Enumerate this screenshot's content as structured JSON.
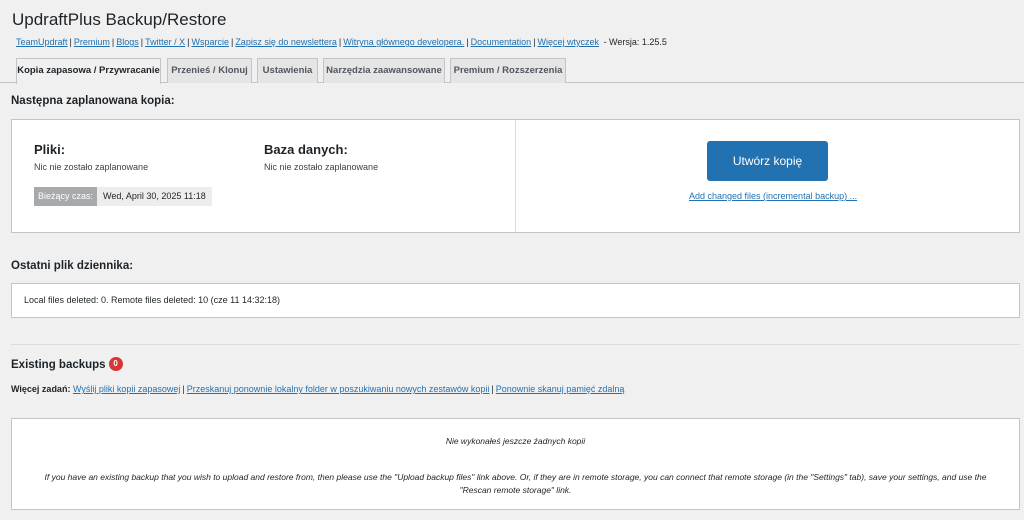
{
  "header": {
    "title": "UpdraftPlus Backup/Restore",
    "links": [
      "TeamUpdraft",
      "Premium",
      "Blogs",
      "Twitter / X",
      "Wsparcie",
      "Zapisz się do newslettera",
      "Witryna głównego developera.",
      "Documentation",
      "Więcej wtyczek"
    ],
    "version": "- Wersja: 1.25.5"
  },
  "tabs": [
    {
      "label": "Kopia zapasowa / Przywracanie",
      "active": true
    },
    {
      "label": "Przenieś / Klonuj",
      "active": false
    },
    {
      "label": "Ustawienia",
      "active": false
    },
    {
      "label": "Narzędzia zaawansowane",
      "active": false
    },
    {
      "label": "Premium / Rozszerzenia",
      "active": false
    }
  ],
  "next_backup": {
    "heading": "Następna zaplanowana kopia:",
    "files_label": "Pliki:",
    "files_value": "Nic nie zostało zaplanowane",
    "db_label": "Baza danych:",
    "db_value": "Nic nie zostało zaplanowane",
    "current_time_label": "Bieżący czas:",
    "current_time_value": "Wed, April 30, 2025 11:18",
    "backup_button": "Utwórz kopię",
    "incremental_link": "Add changed files (incremental backup) ..."
  },
  "log": {
    "heading": "Ostatni plik dziennika:",
    "message": "Local files deleted: 0. Remote files deleted: 10 (cze 11 14:32:18)"
  },
  "existing": {
    "heading": "Existing backups",
    "count": "0",
    "more_tasks_label": "Więcej zadań:",
    "tasks": [
      "Wyślij pliki kopii zapasowej",
      "Przeskanuj ponownie lokalny folder w poszukiwaniu nowych zestawów kopii",
      "Ponownie skanuj pamięć zdalną"
    ],
    "empty_message": "Nie wykonałeś jeszcze żadnych kopii",
    "help_line1": "If you have an existing backup that you wish to upload and restore from, then please use the \"Upload backup files\" link above. Or, if they are in remote storage, you can connect that remote storage (in the \"Settings\" tab), save your settings, and use the",
    "help_line2": "\"Rescan remote storage\" link."
  },
  "colors": {
    "primary": "#2271b1",
    "badge": "#d63638",
    "background": "#f0f0f1"
  }
}
